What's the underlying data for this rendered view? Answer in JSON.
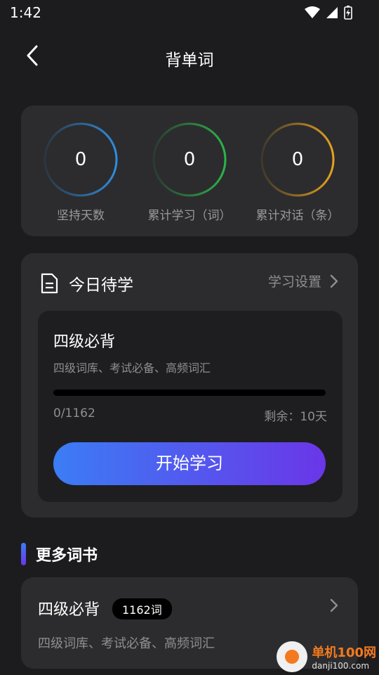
{
  "status_bar": {
    "time": "1:42"
  },
  "header": {
    "title": "背单词"
  },
  "stats": [
    {
      "value": "0",
      "label": "坚持天数",
      "color": "#2f8ee0"
    },
    {
      "value": "0",
      "label": "累计学习（词）",
      "color": "#2bb54a"
    },
    {
      "value": "0",
      "label": "累计对话（条）",
      "color": "#e6a31e"
    }
  ],
  "today": {
    "title": "今日待学",
    "settings_label": "学习设置",
    "book": {
      "name": "四级必背",
      "desc": "四级词库、考试必备、高频词汇",
      "progress_text": "0/1162",
      "progress_fraction": 0,
      "remain_text": "剩余：10天"
    },
    "start_label": "开始学习"
  },
  "more": {
    "title": "更多词书",
    "books": [
      {
        "name": "四级必背",
        "badge": "1162词",
        "desc": "四级词库、考试必备、高频词汇"
      }
    ]
  },
  "watermark": {
    "title": "单机100网",
    "sub": "danji100.com"
  },
  "colors": {
    "accent_start": "#3b7df5",
    "accent_end": "#6a36e8"
  }
}
